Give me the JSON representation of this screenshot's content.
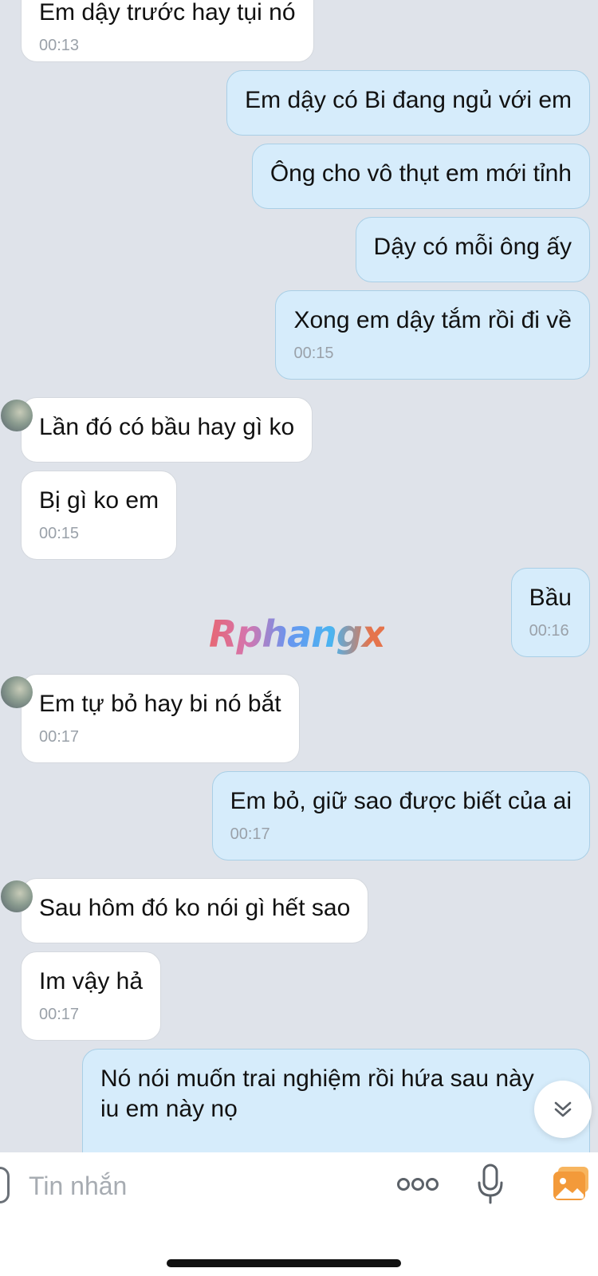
{
  "messages": [
    {
      "side": "in",
      "text": "Em dậy trước hay tụi nó",
      "time": "00:13"
    },
    {
      "side": "out",
      "text": "Em dậy có Bi đang ngủ với em"
    },
    {
      "side": "out",
      "text": "Ông cho vô thụt em mới tỉnh"
    },
    {
      "side": "out",
      "text": "Dậy có mỗi ông ấy"
    },
    {
      "side": "out",
      "text": "Xong em dậy tắm rồi đi về",
      "time": "00:15"
    },
    {
      "side": "in",
      "text": "Lần đó có bầu hay gì ko"
    },
    {
      "side": "in",
      "text": "Bị gì ko em",
      "time": "00:15"
    },
    {
      "side": "out",
      "text": "Bầu",
      "time": "00:16"
    },
    {
      "side": "in",
      "text": "Em tự bỏ hay bi nó bắt",
      "time": "00:17"
    },
    {
      "side": "out",
      "text": "Em bỏ, giữ sao được biết của ai",
      "time": "00:17"
    },
    {
      "side": "in",
      "text": "Sau hôm đó ko nói gì hết sao"
    },
    {
      "side": "in",
      "text": "Im vậy hả",
      "time": "00:17"
    },
    {
      "side": "out",
      "text": "Nó nói muốn trai nghiệm rồi hứa sau này iu em này nọ"
    }
  ],
  "watermark": "Rphangx",
  "input": {
    "placeholder": "Tin nhắn"
  },
  "icons": {
    "sticker": "sticker-icon",
    "more": "more-dots-icon",
    "mic": "microphone-icon",
    "photo": "photo-gallery-icon",
    "scroll_down": "double-chevron-down-icon"
  },
  "colors": {
    "background": "#dfe3ea",
    "incoming_bubble": "#ffffff",
    "outgoing_bubble": "#d6ecfb",
    "timestamp": "#9aa1a9",
    "photo_icon": "#f39a3a"
  }
}
